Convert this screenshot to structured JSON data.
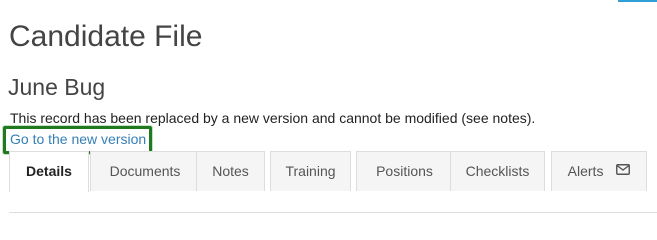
{
  "header": {
    "page_title": "Candidate File",
    "candidate_name": "June Bug"
  },
  "notice": {
    "replaced_message": "This record has been replaced by a new version and cannot be modified (see notes).",
    "new_version_link": "Go to the new version"
  },
  "tabs": [
    {
      "label": "Details",
      "active": true
    },
    {
      "label": "Documents",
      "active": false
    },
    {
      "label": "Notes",
      "active": false
    },
    {
      "label": "Training",
      "active": false
    },
    {
      "label": "Positions",
      "active": false
    },
    {
      "label": "Checklists",
      "active": false
    },
    {
      "label": "Alerts",
      "active": false,
      "icon": "envelope-icon"
    }
  ],
  "colors": {
    "link": "#357fb6",
    "highlight_border": "#1f7a1f",
    "top_accent": "#2f9fd8"
  }
}
